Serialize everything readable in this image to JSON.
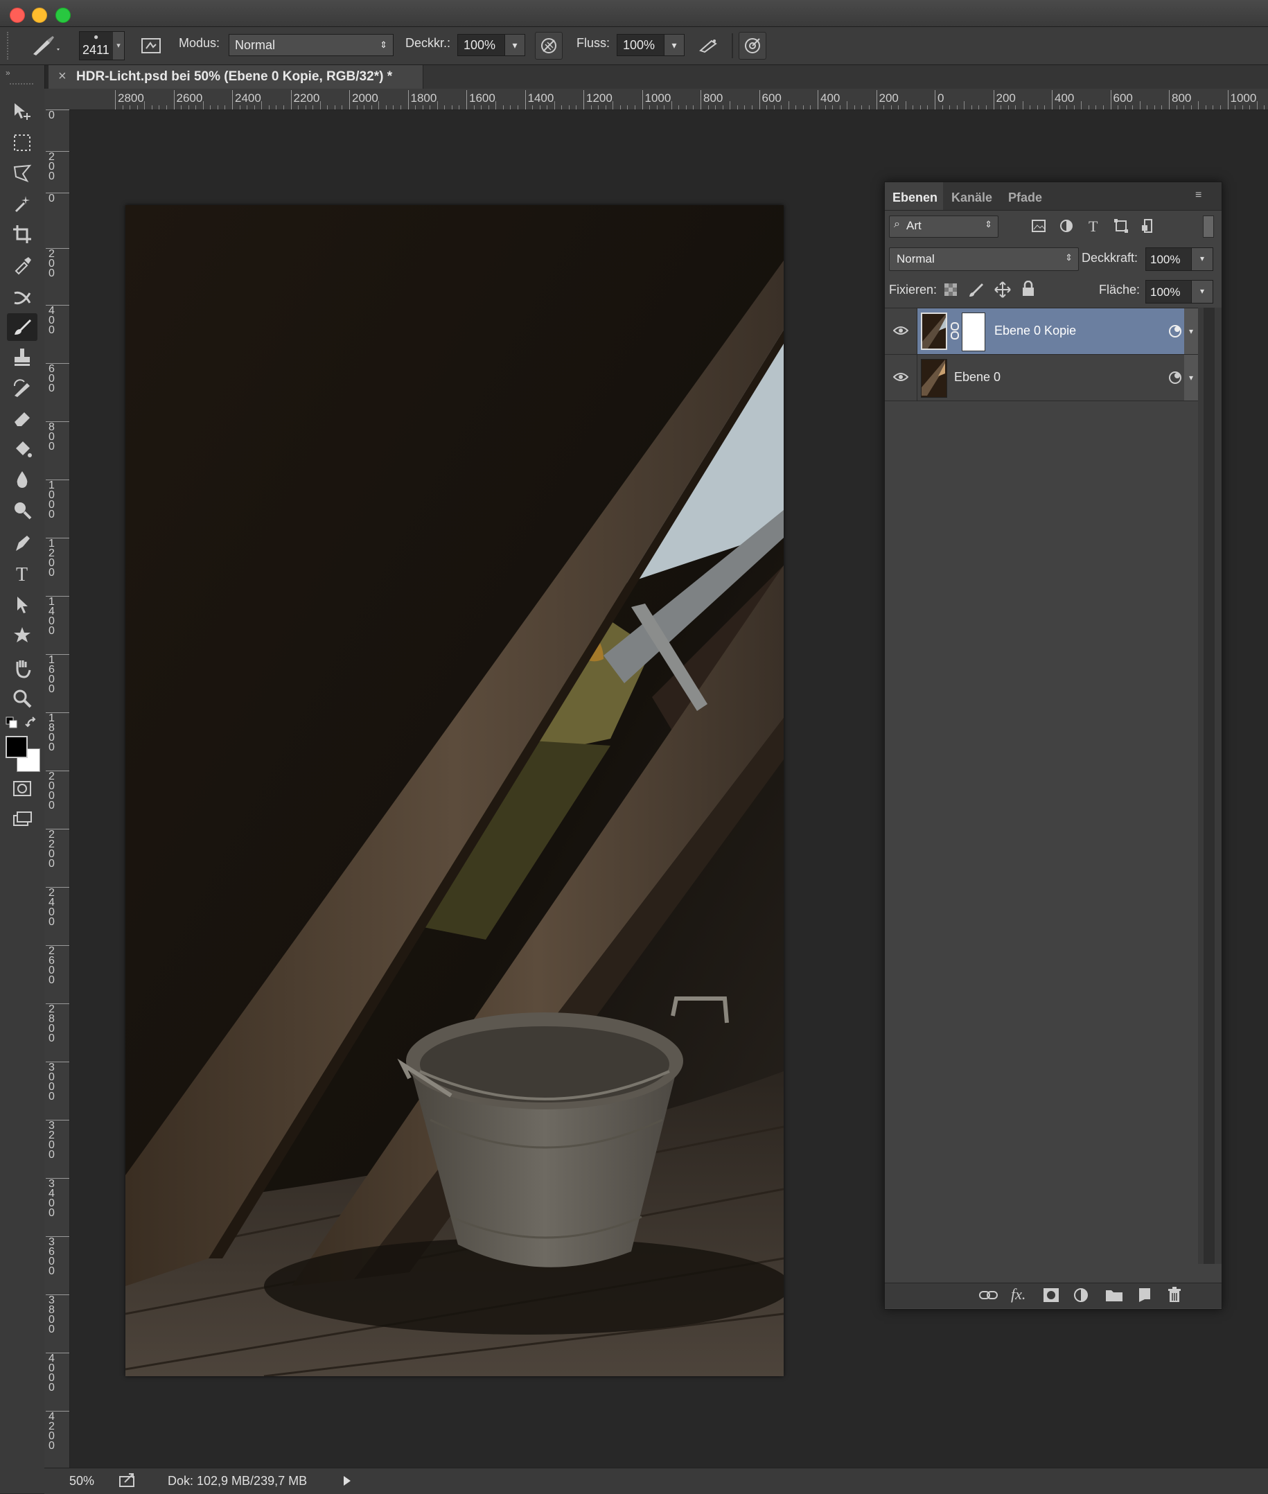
{
  "window": {
    "lights": {
      "close": "#ff5f57",
      "minimize": "#ffbd2e",
      "zoom": "#28c840"
    }
  },
  "options": {
    "brush_size": "2411",
    "modus_label": "Modus:",
    "modus_value": "Normal",
    "deckkr_label": "Deckkr.:",
    "deckkr_value": "100%",
    "fluss_label": "Fluss:",
    "fluss_value": "100%"
  },
  "document": {
    "tab_title": "HDR-Licht.psd bei 50% (Ebene 0 Kopie, RGB/32*) *",
    "close_glyph": "×"
  },
  "rulers": {
    "horizontal": [
      "2800",
      "2600",
      "2400",
      "2200",
      "2000",
      "1800",
      "1600",
      "1400",
      "1200",
      "1000",
      "800",
      "600",
      "400",
      "200",
      "0",
      "200",
      "400",
      "600",
      "800",
      "1000"
    ],
    "vertical": [
      "0",
      "200",
      "0",
      "200",
      "400",
      "600",
      "800",
      "1000",
      "1200",
      "1400",
      "1600",
      "1800",
      "2000",
      "2200",
      "2400",
      "2600",
      "2800",
      "3000",
      "3200",
      "3400",
      "3600",
      "3800",
      "4000",
      "4200"
    ]
  },
  "layers_panel": {
    "tabs": [
      "Ebenen",
      "Kanäle",
      "Pfade"
    ],
    "filter_label": "Art",
    "blend_mode": "Normal",
    "deckkraft_label": "Deckkraft:",
    "deckkraft_value": "100%",
    "fixieren_label": "Fixieren:",
    "flaeche_label": "Fläche:",
    "flaeche_value": "100%",
    "layers": [
      {
        "name": "Ebene 0 Kopie",
        "selected": true,
        "has_mask": true
      },
      {
        "name": "Ebene 0",
        "selected": false,
        "has_mask": false
      }
    ]
  },
  "status": {
    "zoom": "50%",
    "doc_info": "Dok: 102,9 MB/239,7 MB"
  },
  "colors": {
    "accent_selected_layer": "#6b7fa0",
    "ui_dark": "#282828"
  }
}
